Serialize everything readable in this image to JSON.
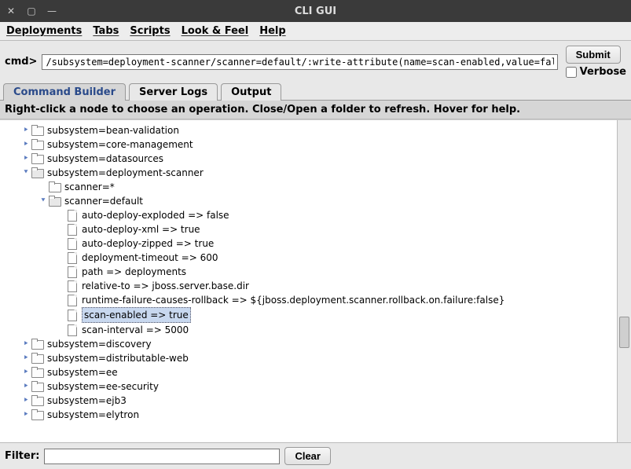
{
  "window": {
    "title": "CLI GUI"
  },
  "menubar": [
    "Deployments",
    "Tabs",
    "Scripts",
    "Look & Feel",
    "Help"
  ],
  "cmd": {
    "label": "cmd>",
    "value": "/subsystem=deployment-scanner/scanner=default/:write-attribute(name=scan-enabled,value=false)",
    "submit": "Submit",
    "verbose": "Verbose"
  },
  "tabs": [
    "Command Builder",
    "Server Logs",
    "Output"
  ],
  "activeTab": 0,
  "hint": "Right-click a node to choose an operation.   Close/Open a folder to refresh.   Hover for help.",
  "tree": [
    {
      "depth": 0,
      "kind": "folder",
      "toggle": "closed",
      "label": "subsystem=bean-validation"
    },
    {
      "depth": 0,
      "kind": "folder",
      "toggle": "closed",
      "label": "subsystem=core-management"
    },
    {
      "depth": 0,
      "kind": "folder",
      "toggle": "closed",
      "label": "subsystem=datasources"
    },
    {
      "depth": 0,
      "kind": "folder",
      "toggle": "open",
      "label": "subsystem=deployment-scanner"
    },
    {
      "depth": 1,
      "kind": "folder",
      "toggle": "none",
      "label": "scanner=*"
    },
    {
      "depth": 1,
      "kind": "folder",
      "toggle": "open",
      "label": "scanner=default"
    },
    {
      "depth": 2,
      "kind": "file",
      "toggle": "none",
      "label": "auto-deploy-exploded => false"
    },
    {
      "depth": 2,
      "kind": "file",
      "toggle": "none",
      "label": "auto-deploy-xml => true"
    },
    {
      "depth": 2,
      "kind": "file",
      "toggle": "none",
      "label": "auto-deploy-zipped => true"
    },
    {
      "depth": 2,
      "kind": "file",
      "toggle": "none",
      "label": "deployment-timeout => 600"
    },
    {
      "depth": 2,
      "kind": "file",
      "toggle": "none",
      "label": "path => deployments"
    },
    {
      "depth": 2,
      "kind": "file",
      "toggle": "none",
      "label": "relative-to => jboss.server.base.dir"
    },
    {
      "depth": 2,
      "kind": "file",
      "toggle": "none",
      "label": "runtime-failure-causes-rollback => ${jboss.deployment.scanner.rollback.on.failure:false}"
    },
    {
      "depth": 2,
      "kind": "file",
      "toggle": "none",
      "label": "scan-enabled => true",
      "selected": true
    },
    {
      "depth": 2,
      "kind": "file",
      "toggle": "none",
      "label": "scan-interval => 5000"
    },
    {
      "depth": 0,
      "kind": "folder",
      "toggle": "closed",
      "label": "subsystem=discovery"
    },
    {
      "depth": 0,
      "kind": "folder",
      "toggle": "closed",
      "label": "subsystem=distributable-web"
    },
    {
      "depth": 0,
      "kind": "folder",
      "toggle": "closed",
      "label": "subsystem=ee"
    },
    {
      "depth": 0,
      "kind": "folder",
      "toggle": "closed",
      "label": "subsystem=ee-security"
    },
    {
      "depth": 0,
      "kind": "folder",
      "toggle": "closed",
      "label": "subsystem=ejb3"
    },
    {
      "depth": 0,
      "kind": "folder",
      "toggle": "closed",
      "label": "subsystem=elytron"
    }
  ],
  "filter": {
    "label": "Filter:",
    "clear": "Clear",
    "value": ""
  }
}
